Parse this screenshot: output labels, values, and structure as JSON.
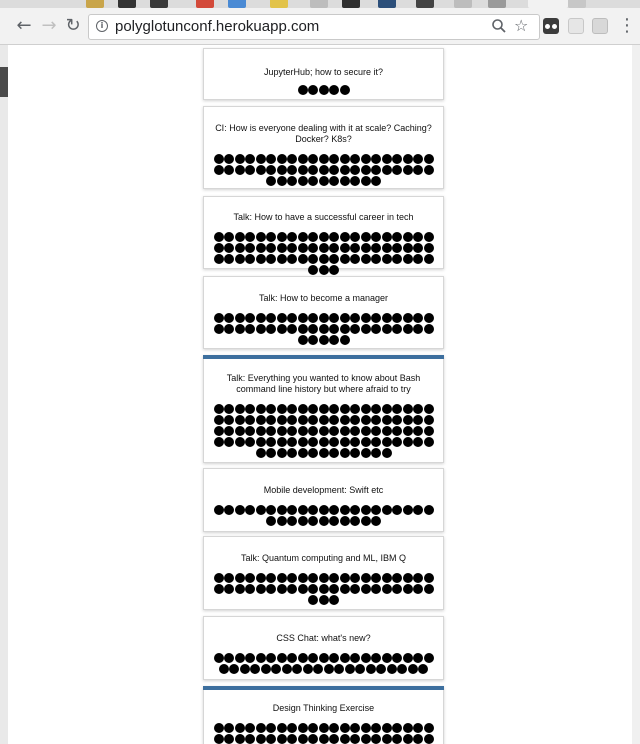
{
  "browser": {
    "url": "polyglotunconf.herokuapp.com",
    "nav": {
      "back_icon": "arrow-left-icon",
      "forward_icon": "arrow-right-icon",
      "reload_icon": "reload-icon"
    }
  },
  "cards": [
    {
      "title": "JupyterHub; how to secure it?",
      "votes": 5,
      "selected": false
    },
    {
      "title": "CI: How is everyone dealing with it at scale? Caching? Docker? K8s?",
      "votes": 53,
      "selected": false
    },
    {
      "title": "Talk: How to have a successful career in tech",
      "votes": 66,
      "selected": false
    },
    {
      "title": "Talk: How to become a manager",
      "votes": 47,
      "selected": false
    },
    {
      "title": "Talk: Everything you wanted to know about Bash command line history but where afraid to try",
      "votes": 97,
      "selected": true
    },
    {
      "title": "Mobile development: Swift etc",
      "votes": 32,
      "selected": false
    },
    {
      "title": "Talk: Quantum computing and ML, IBM Q",
      "votes": 45,
      "selected": false
    },
    {
      "title": "CSS Chat: what's new?",
      "votes": 41,
      "selected": false
    },
    {
      "title": "Design Thinking Exercise",
      "votes": 43,
      "selected": true
    }
  ]
}
